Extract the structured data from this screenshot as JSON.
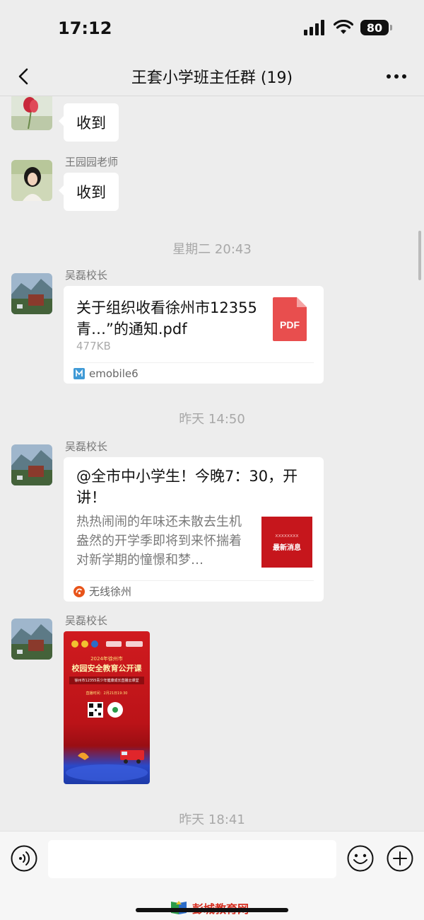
{
  "status_bar": {
    "time": "17:12",
    "battery": "80"
  },
  "header": {
    "title": "王套小学班主任群 (19)"
  },
  "messages": [
    {
      "sender": "",
      "text": "收到"
    },
    {
      "sender": "王园园老师",
      "text": "收到"
    }
  ],
  "timestamps": [
    "星期二 20:43",
    "昨天 14:50",
    "昨天 18:41"
  ],
  "file_message": {
    "sender": "吴磊校长",
    "file_name": "关于组织收看徐州市12355青…”的通知.pdf",
    "file_type": "PDF",
    "file_size": "477KB",
    "source": "emobile6"
  },
  "article_message": {
    "sender": "吴磊校长",
    "title": "@全市中小学生！今晚7：30，开讲！",
    "description": "热热闹闹的年味还未散去生机盎然的开学季即将到来怀揣着对新学期的憧憬和梦…",
    "thumb_small": "xxxxxxxx",
    "thumb_main": "最新消息",
    "source": "无线徐州"
  },
  "image_message": {
    "sender": "吴磊校长",
    "poster_line1": "2024年徐州市",
    "poster_line2": "校园安全教育公开课",
    "poster_line3": "徐州市12355青少年健康成长直播云课堂",
    "poster_line4": "直播时间：2月21日19:30"
  },
  "input_bar": {
    "placeholder": ""
  },
  "watermark": {
    "text": "彭城教育网"
  },
  "colors": {
    "accent_pdf": "#e84e4e",
    "poster_red": "#c8171c",
    "background": "#ededed"
  }
}
